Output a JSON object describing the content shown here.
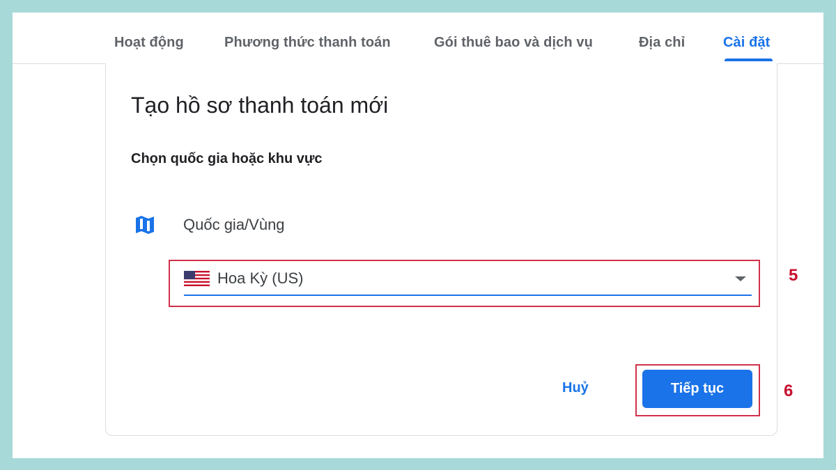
{
  "tabs": [
    {
      "label": "Hoạt động",
      "active": false
    },
    {
      "label": "Phương thức thanh toán",
      "active": false
    },
    {
      "label": "Gói thuê bao và dịch vụ",
      "active": false
    },
    {
      "label": "Địa chỉ",
      "active": false
    },
    {
      "label": "Cài đặt",
      "active": true
    }
  ],
  "dialog": {
    "title": "Tạo hồ sơ thanh toán mới",
    "subtitle": "Chọn quốc gia hoặc khu vực",
    "field_icon": "map-icon",
    "field_label": "Quốc gia/Vùng",
    "country": {
      "value": "Hoa Kỳ (US)",
      "flag_icon": "us-flag-icon"
    },
    "cancel_label": "Huỷ",
    "continue_label": "Tiếp tục"
  },
  "annotations": {
    "step_country": "5",
    "step_continue": "6"
  },
  "colors": {
    "accent": "#1a73e8",
    "background": "#a8d9d9",
    "annotation": "#d0314a",
    "annotation_text": "#c8102e"
  }
}
